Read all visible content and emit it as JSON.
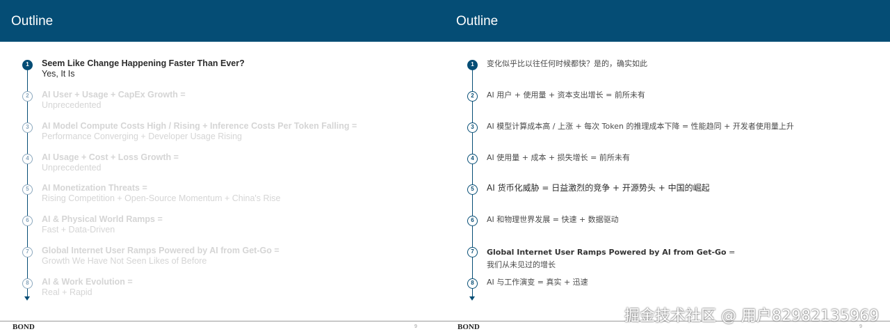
{
  "left": {
    "title": "Outline",
    "items": [
      {
        "num": "1",
        "line1": "Seem Like Change Happening Faster Than Ever?",
        "line2": "Yes, It Is"
      },
      {
        "num": "2",
        "line1": "AI User + Usage + CapEx Growth =",
        "line2": "Unprecedented"
      },
      {
        "num": "3",
        "line1": "AI Model Compute Costs High / Rising + Inference Costs Per Token Falling =",
        "line2": "Performance Converging + Developer Usage Rising"
      },
      {
        "num": "4",
        "line1": "AI Usage + Cost + Loss Growth =",
        "line2": "Unprecedented"
      },
      {
        "num": "5",
        "line1": "AI Monetization Threats =",
        "line2": "Rising Competition + Open-Source Momentum + China's Rise"
      },
      {
        "num": "6",
        "line1": "AI & Physical World Ramps =",
        "line2": "Fast + Data-Driven"
      },
      {
        "num": "7",
        "line1": "Global Internet User Ramps Powered by AI from Get-Go =",
        "line2": "Growth We Have Not Seen Likes of Before"
      },
      {
        "num": "8",
        "line1": "AI & Work Evolution =",
        "line2": "Real + Rapid"
      }
    ],
    "footer_brand": "BOND",
    "page_number": "9"
  },
  "right": {
    "title": "Outline",
    "items": [
      {
        "num": "1",
        "text": "变化似乎比以往任何时候都快？是的，确实如此"
      },
      {
        "num": "2",
        "text": "AI 用户 + 使用量 + 资本支出增长 = 前所未有"
      },
      {
        "num": "3",
        "text": "AI 模型计算成本高 / 上涨 + 每次 Token 的推理成本下降 = 性能趋同 + 开发者使用量上升"
      },
      {
        "num": "4",
        "text": "AI 使用量 + 成本 + 损失增长 = 前所未有"
      },
      {
        "num": "5",
        "text": "AI 货币化威胁 = 日益激烈的竞争 + 开源势头 + 中国的崛起"
      },
      {
        "num": "6",
        "text": "AI 和物理世界发展 = 快速 + 数据驱动"
      },
      {
        "num": "7",
        "text_bold": "Global Internet User Ramps Powered by AI from Get-Go",
        "text": " = 我们从未见过的增长"
      },
      {
        "num": "8",
        "text": "AI 与工作演变 = 真实 + 迅速"
      }
    ],
    "footer_brand": "BOND",
    "page_number": "9"
  },
  "watermark": "掘金技术社区 @ 用户82982135969"
}
